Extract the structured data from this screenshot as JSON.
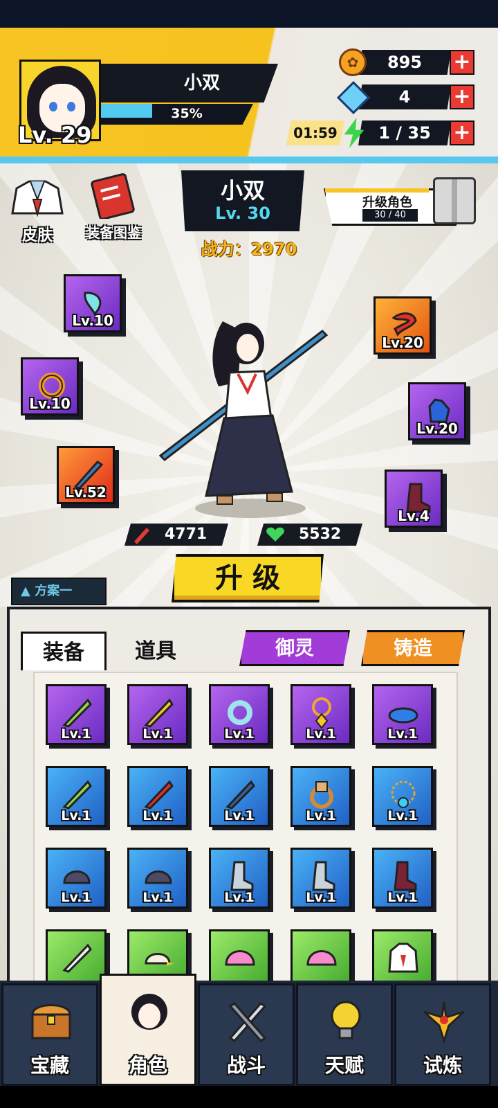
{
  "header": {
    "player_level": "Lv. 29",
    "player_name": "小双",
    "exp_percent_label": "35%",
    "exp_fraction": 0.35,
    "coins": "895",
    "gems": "4",
    "stamina_timer": "01:59",
    "stamina": "1 / 35",
    "plus": "+"
  },
  "side": {
    "skin_label": "皮肤",
    "codex_label": "装备图鉴"
  },
  "character": {
    "name": "小双",
    "level": "Lv. 30",
    "power": "战力：2970",
    "upgrade_title": "升级角色",
    "upgrade_progress": "30 / 40",
    "attack": "4771",
    "hp": "5532"
  },
  "equipped": [
    {
      "id": "charm",
      "level": "Lv.10"
    },
    {
      "id": "scarf",
      "level": "Lv.20"
    },
    {
      "id": "ring",
      "level": "Lv.10"
    },
    {
      "id": "gloves",
      "level": "Lv.20"
    },
    {
      "id": "sword",
      "level": "Lv.52"
    },
    {
      "id": "boots",
      "level": "Lv.4"
    }
  ],
  "actions": {
    "upgrade": "升 级",
    "plan": "方案一"
  },
  "inventory": {
    "tab_equipment": "装备",
    "tab_items": "道具",
    "btn_spirit": "御灵",
    "btn_forge": "铸造",
    "level": "Lv.1"
  },
  "nav": {
    "treasure": "宝藏",
    "character": "角色",
    "battle": "战斗",
    "talent": "天赋",
    "trial": "试炼"
  },
  "colors": {
    "accent_yellow": "#f7c424",
    "accent_blue": "#52c9ef",
    "rarity_purple": "#8a3fd6",
    "rarity_blue": "#2f86e0",
    "rarity_green": "#66c844",
    "plus_red": "#e93a33"
  }
}
